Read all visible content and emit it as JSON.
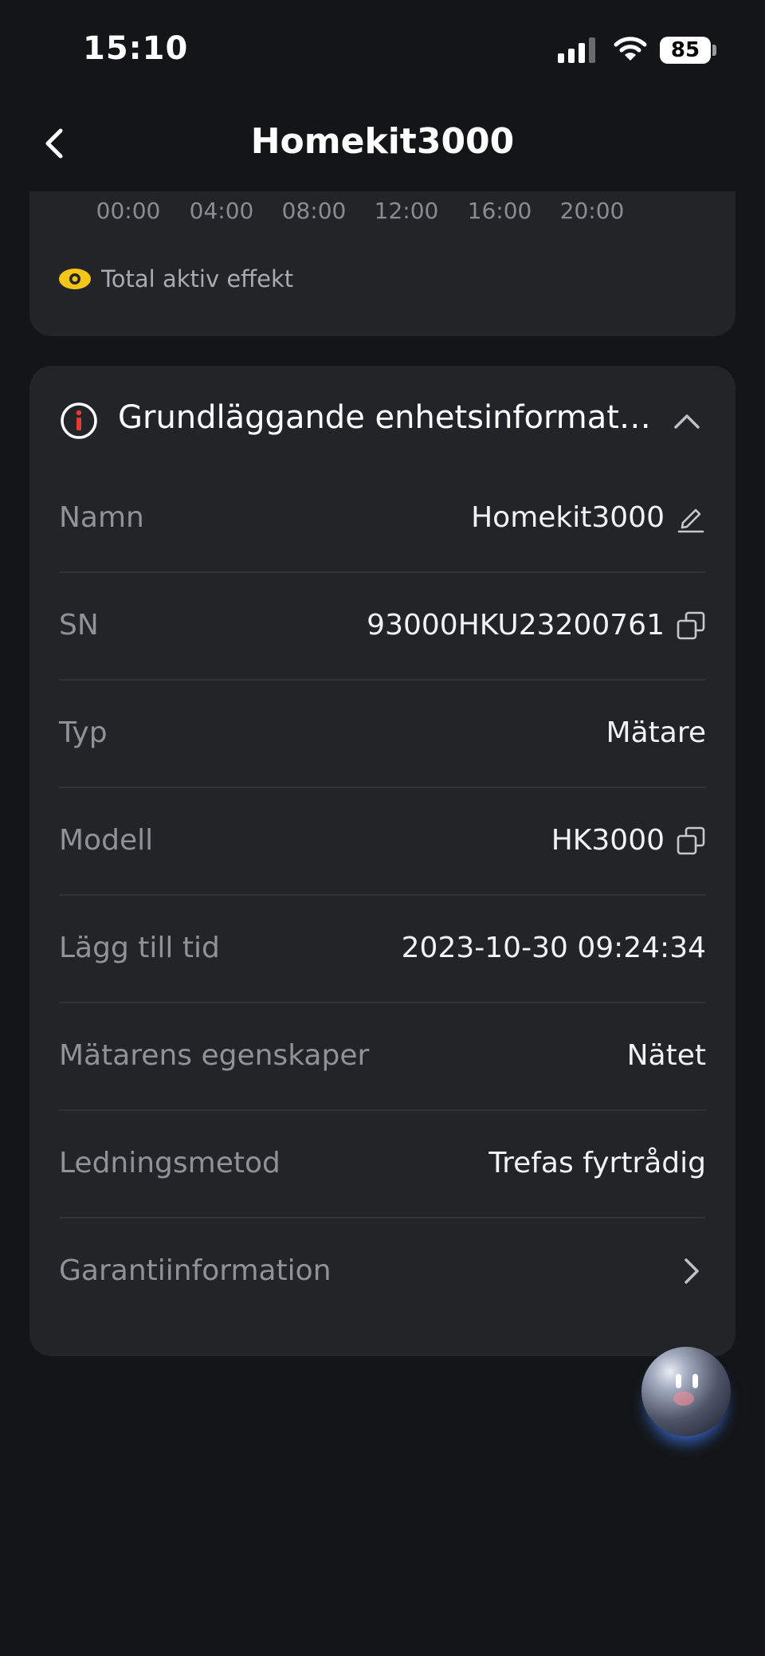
{
  "status_bar": {
    "time": "15:10",
    "battery": "85"
  },
  "nav": {
    "title": "Homekit3000"
  },
  "chart": {
    "ticks": [
      "00:00",
      "04:00",
      "08:00",
      "12:00",
      "16:00",
      "20:00"
    ],
    "legend": "Total aktiv effekt",
    "legend_color": "#f5c518"
  },
  "info": {
    "title": "Grundläggande enhetsinformat…",
    "rows": [
      {
        "label": "Namn",
        "value": "Homekit3000",
        "icon": "edit-icon"
      },
      {
        "label": "SN",
        "value": "93000HKU23200761",
        "icon": "copy-icon"
      },
      {
        "label": "Typ",
        "value": "Mätare"
      },
      {
        "label": "Modell",
        "value": "HK3000",
        "icon": "copy-icon"
      },
      {
        "label": "Lägg till tid",
        "value": "2023-10-30 09:24:34"
      },
      {
        "label": "Mätarens egenskaper",
        "value": "Nätet"
      },
      {
        "label": "Ledningsmetod",
        "value": "Trefas fyrtrådig"
      },
      {
        "label": "Garantiinformation",
        "icon": "chevron-right-icon"
      }
    ]
  },
  "colors": {
    "background": "#131517",
    "card": "#222428",
    "accent_red": "#e53935"
  }
}
